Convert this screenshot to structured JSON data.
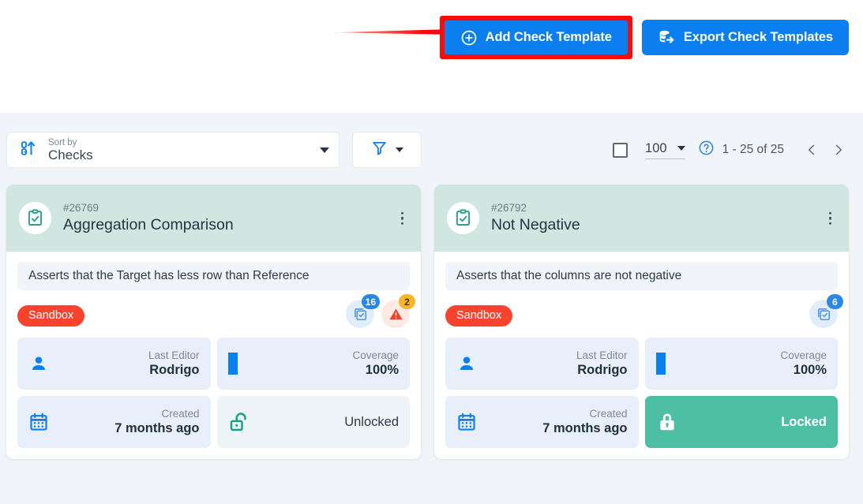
{
  "header": {
    "add_button_label": "Add Check Template",
    "add_button_icon": "plus-circle-icon",
    "export_button_label": "Export Check Templates",
    "export_button_icon": "database-export-icon",
    "highlight_color": "#fb0a0a",
    "button_color": "#0b7ff0",
    "annotation": "red-arrow-pointing-to-add-check-template"
  },
  "toolbar": {
    "sort": {
      "icon": "sort-ascending-numeric-icon",
      "label": "Sort by",
      "value": "Checks",
      "caret": "chevron-down-icon"
    },
    "filter": {
      "icon": "filter-funnel-icon",
      "caret": "chevron-down-icon"
    },
    "pagination": {
      "select_all_checkbox": "unchecked",
      "page_size": "100",
      "page_size_caret": "chevron-down-icon",
      "help_icon": "question-circle-icon",
      "range_text": "1 - 25 of 25",
      "prev_icon": "chevron-left-icon",
      "next_icon": "chevron-right-icon"
    }
  },
  "cards": [
    {
      "icon": "clipboard-check-icon",
      "id": "#26769",
      "title": "Aggregation Comparison",
      "menu_icon": "kebab-menu-icon",
      "description": "Asserts that the Target has less row than Reference",
      "tag": "Sandbox",
      "tag_color": "#f8442f",
      "counters": [
        {
          "icon": "check-square-icon",
          "count": "16",
          "tone": "blue"
        },
        {
          "icon": "warning-triangle-icon",
          "count": "2",
          "tone": "amber"
        }
      ],
      "tiles": [
        {
          "icon": "person-icon",
          "label": "Last Editor",
          "value": "Rodrigo",
          "style": "info"
        },
        {
          "icon": "coverage-bar-icon",
          "label": "Coverage",
          "value": "100%",
          "style": "info"
        },
        {
          "icon": "calendar-icon",
          "label": "Created",
          "value": "7 months ago",
          "style": "info"
        },
        {
          "icon": "unlock-icon",
          "value": "Unlocked",
          "style": "plain"
        }
      ]
    },
    {
      "icon": "clipboard-check-icon",
      "id": "#26792",
      "title": "Not Negative",
      "menu_icon": "kebab-menu-icon",
      "description": "Asserts that the columns are not negative",
      "tag": "Sandbox",
      "tag_color": "#f8442f",
      "counters": [
        {
          "icon": "check-square-icon",
          "count": "6",
          "tone": "blue"
        }
      ],
      "tiles": [
        {
          "icon": "person-icon",
          "label": "Last Editor",
          "value": "Rodrigo",
          "style": "info"
        },
        {
          "icon": "coverage-bar-icon",
          "label": "Coverage",
          "value": "100%",
          "style": "info"
        },
        {
          "icon": "calendar-icon",
          "label": "Created",
          "value": "7 months ago",
          "style": "info"
        },
        {
          "icon": "lock-icon",
          "value": "Locked",
          "style": "locked"
        }
      ]
    }
  ]
}
